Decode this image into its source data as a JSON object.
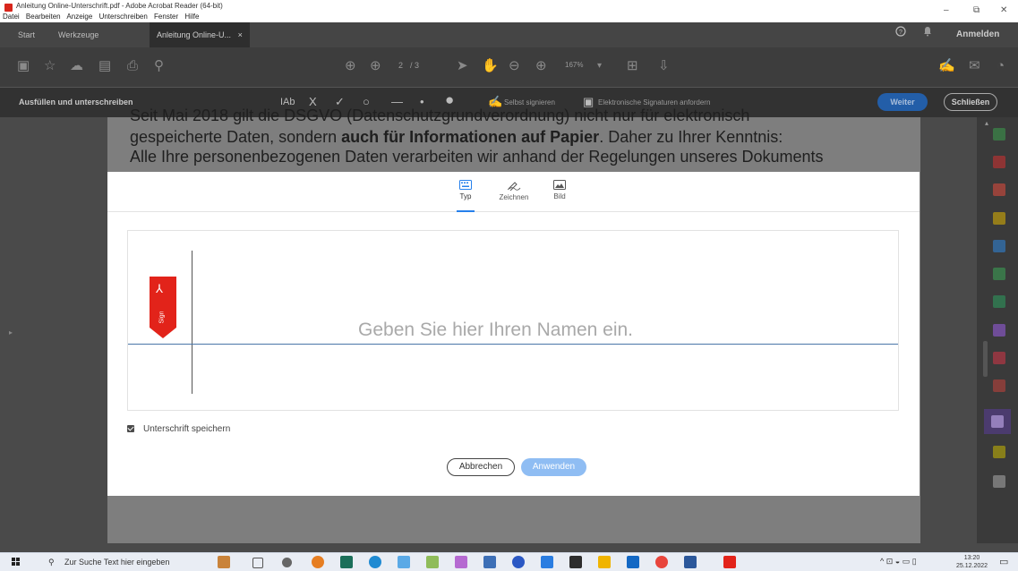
{
  "window": {
    "title": "Anleitung Online-Unterschrift.pdf - Adobe Acrobat Reader (64-bit)",
    "menu": [
      "Datei",
      "Bearbeiten",
      "Anzeige",
      "Unterschreiben",
      "Fenster",
      "Hilfe"
    ],
    "controls": {
      "minimize": "–",
      "maximize": "⧉",
      "close": "✕"
    }
  },
  "tabs": {
    "start": "Start",
    "werkzeuge": "Werkzeuge",
    "document": "Anleitung Online-U...",
    "close": "×",
    "sign_in": "Anmelden"
  },
  "toolbar": {
    "page_current": "2",
    "page_total": "/ 3",
    "zoom": "167%"
  },
  "fillsign": {
    "label": "Ausfüllen und unterschreiben",
    "text_tool": "IAb",
    "selbst_signieren": "Selbst signieren",
    "elektronische": "Elektronische Signaturen anfordern",
    "weiter": "Weiter",
    "schliessen": "Schließen"
  },
  "document": {
    "line0": "Seit Mai 2018 gilt die DSGVO (Datenschutzgrundverordnung) nicht nur für elektronisch",
    "line1_a": "gespeicherte Daten, sondern ",
    "line1_b": "auch für Informationen auf Papier",
    "line1_c": ". Daher zu Ihrer Kenntnis:",
    "line2": "Alle Ihre personenbezogenen Daten verarbeiten wir anhand der Regelungen unseres Dokuments"
  },
  "dialog": {
    "tabs": [
      {
        "label": "Typ",
        "icon": "keyboard-icon"
      },
      {
        "label": "Zeichnen",
        "icon": "pen-draw-icon"
      },
      {
        "label": "Bild",
        "icon": "image-icon"
      }
    ],
    "sign_tag": "Sign",
    "placeholder": "Geben Sie hier Ihren Namen ein.",
    "save_signature": "Unterschrift speichern",
    "save_checked": true,
    "cancel": "Abbrechen",
    "apply": "Anwenden"
  },
  "taskbar": {
    "search_placeholder": "Zur Suche Text hier eingeben",
    "time": "13:20",
    "date": "25.12.2022"
  },
  "colors": {
    "accent": "#2680eb",
    "acrobat_red": "#e2231a",
    "apply_disabled": "#8fbdf3"
  }
}
